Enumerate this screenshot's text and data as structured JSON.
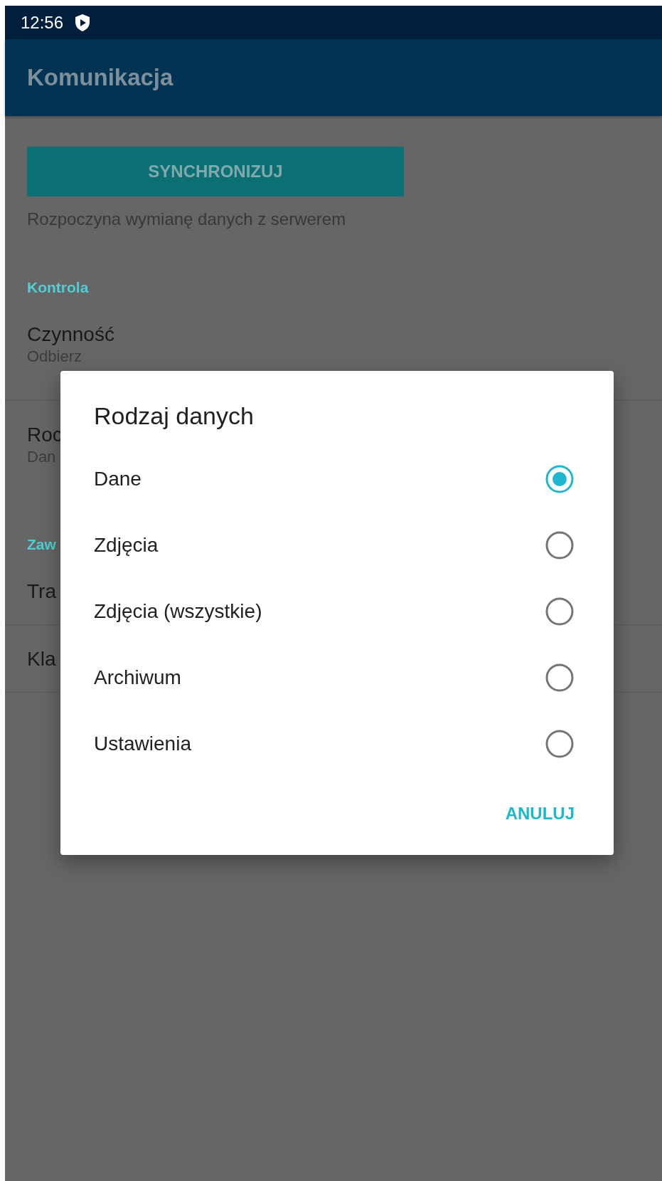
{
  "status_bar": {
    "time": "12:56"
  },
  "app_bar": {
    "title": "Komunikacja"
  },
  "sync_button": {
    "label": "SYNCHRONIZUJ"
  },
  "sync_description": "Rozpoczyna wymianę danych z serwerem",
  "sections": [
    {
      "header": "Kontrola",
      "items": [
        {
          "title": "Czynność",
          "summary": "Odbierz"
        },
        {
          "title": "Roc",
          "summary": "Dan"
        }
      ]
    },
    {
      "header": "Zaw",
      "items": [
        {
          "title": "Tra"
        },
        {
          "title": "Kla"
        }
      ]
    }
  ],
  "dialog": {
    "title": "Rodzaj danych",
    "options": [
      {
        "label": "Dane",
        "selected": true
      },
      {
        "label": "Zdjęcia",
        "selected": false
      },
      {
        "label": "Zdjęcia (wszystkie)",
        "selected": false
      },
      {
        "label": "Archiwum",
        "selected": false
      },
      {
        "label": "Ustawienia",
        "selected": false
      }
    ],
    "cancel": "ANULUJ"
  }
}
